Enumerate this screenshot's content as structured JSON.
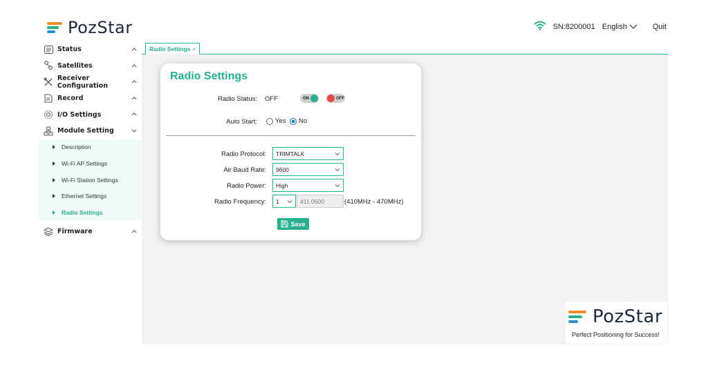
{
  "header": {
    "brand": "PozStar",
    "sn": "SN:8200001",
    "language": "English",
    "quit": "Quit"
  },
  "colors": {
    "accent": "#26b08e",
    "logo_orange": "#f28c28",
    "logo_teal": "#26b08e",
    "logo_blue": "#2c8fd6",
    "toggle_on": "#26b08e",
    "toggle_off": "#e8474c"
  },
  "sidebar": {
    "items": [
      {
        "label": "Status",
        "icon": "status-icon"
      },
      {
        "label": "Satellites",
        "icon": "satellite-icon"
      },
      {
        "label": "Receiver Configuration",
        "icon": "tools-icon"
      },
      {
        "label": "Record",
        "icon": "record-icon"
      },
      {
        "label": "I/O Settings",
        "icon": "io-gear-icon"
      },
      {
        "label": "Module Setting",
        "icon": "module-icon"
      }
    ],
    "subitems": [
      {
        "label": "Description"
      },
      {
        "label": "Wi-Fi AP Settings"
      },
      {
        "label": "Wi-Fi Station Settings"
      },
      {
        "label": "Ethernet Settings"
      },
      {
        "label": "Radio Settings"
      }
    ],
    "firmware": {
      "label": "Firmware",
      "icon": "layers-icon"
    }
  },
  "tab": {
    "label": "Radio Settings",
    "close": "×"
  },
  "card": {
    "title": "Radio Settings",
    "radio_status_label": "Radio Status:",
    "radio_status_value": "OFF",
    "toggle_on_label": "ON",
    "toggle_off_label": "OFF",
    "auto_start_label": "Auto Start:",
    "auto_start_yes": "Yes",
    "auto_start_no": "No",
    "auto_start_selected": "No",
    "protocol_label": "Radio Protocol:",
    "protocol_value": "TRIMTALK",
    "baud_label": "Air Baud Rate:",
    "baud_value": "9600",
    "power_label": "Radio Power:",
    "power_value": "High",
    "freq_label": "Radio Frequency:",
    "freq_channel": "1",
    "freq_value": "411.0500",
    "freq_range": "(410MHz - 470MHz)",
    "save_label": "Save"
  },
  "brand_box": {
    "brand": "PozStar",
    "tagline": "Perfect Positioning for Success!"
  }
}
